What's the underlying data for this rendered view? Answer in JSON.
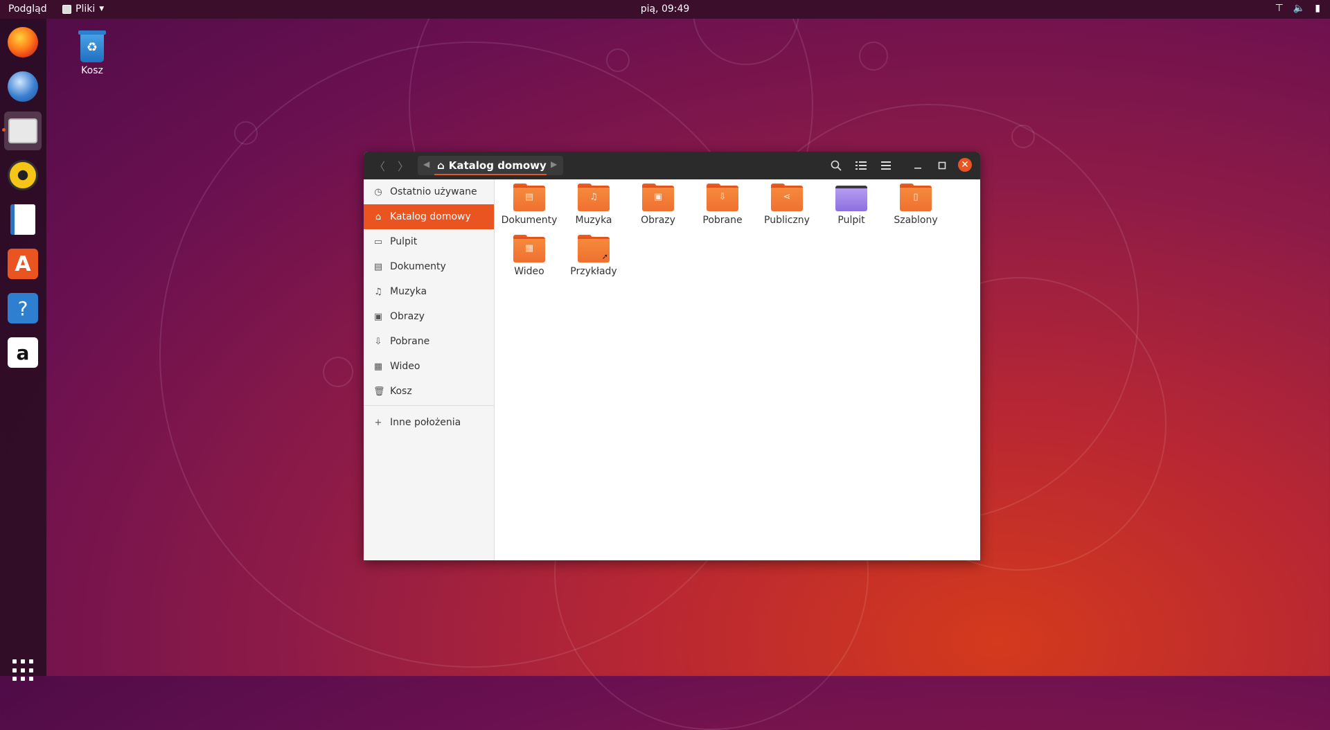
{
  "top_panel": {
    "activities": "Podgląd",
    "app_menu": "Pliki",
    "clock": "pią, 09:49",
    "tray": {
      "network_icon": "⊤",
      "volume_icon": "🔈",
      "power_icon": "▮"
    }
  },
  "dock": {
    "items": [
      {
        "name": "firefox",
        "color": "#ff7a1a"
      },
      {
        "name": "thunderbird",
        "color": "#3a7fd0"
      },
      {
        "name": "files",
        "color": "#d8d8d8"
      },
      {
        "name": "rhythmbox",
        "color": "#f5c518"
      },
      {
        "name": "libreoffice-writer",
        "color": "#2a72c4"
      },
      {
        "name": "ubuntu-software",
        "color": "#e95420"
      },
      {
        "name": "help",
        "color": "#2f7fd1"
      },
      {
        "name": "amazon",
        "color": "#ffffff"
      }
    ]
  },
  "desktop": {
    "trash_label": "Kosz"
  },
  "window": {
    "path": "Katalog domowy",
    "sidebar": [
      {
        "label": "Ostatnio używane",
        "icon": "clock-icon"
      },
      {
        "label": "Katalog domowy",
        "icon": "home-icon"
      },
      {
        "label": "Pulpit",
        "icon": "desktop-icon"
      },
      {
        "label": "Dokumenty",
        "icon": "document-icon"
      },
      {
        "label": "Muzyka",
        "icon": "music-icon"
      },
      {
        "label": "Obrazy",
        "icon": "image-icon"
      },
      {
        "label": "Pobrane",
        "icon": "download-icon"
      },
      {
        "label": "Wideo",
        "icon": "video-icon"
      },
      {
        "label": "Kosz",
        "icon": "trash-icon"
      }
    ],
    "other_locations": "Inne położenia",
    "folders": [
      {
        "label": "Dokumenty",
        "emblem": "▤"
      },
      {
        "label": "Muzyka",
        "emblem": "♫"
      },
      {
        "label": "Obrazy",
        "emblem": "▣"
      },
      {
        "label": "Pobrane",
        "emblem": "⇩"
      },
      {
        "label": "Publiczny",
        "emblem": "⋖"
      },
      {
        "label": "Pulpit",
        "emblem": ""
      },
      {
        "label": "Szablony",
        "emblem": "▯"
      },
      {
        "label": "Wideo",
        "emblem": "▦"
      },
      {
        "label": "Przykłady",
        "emblem": ""
      }
    ]
  }
}
